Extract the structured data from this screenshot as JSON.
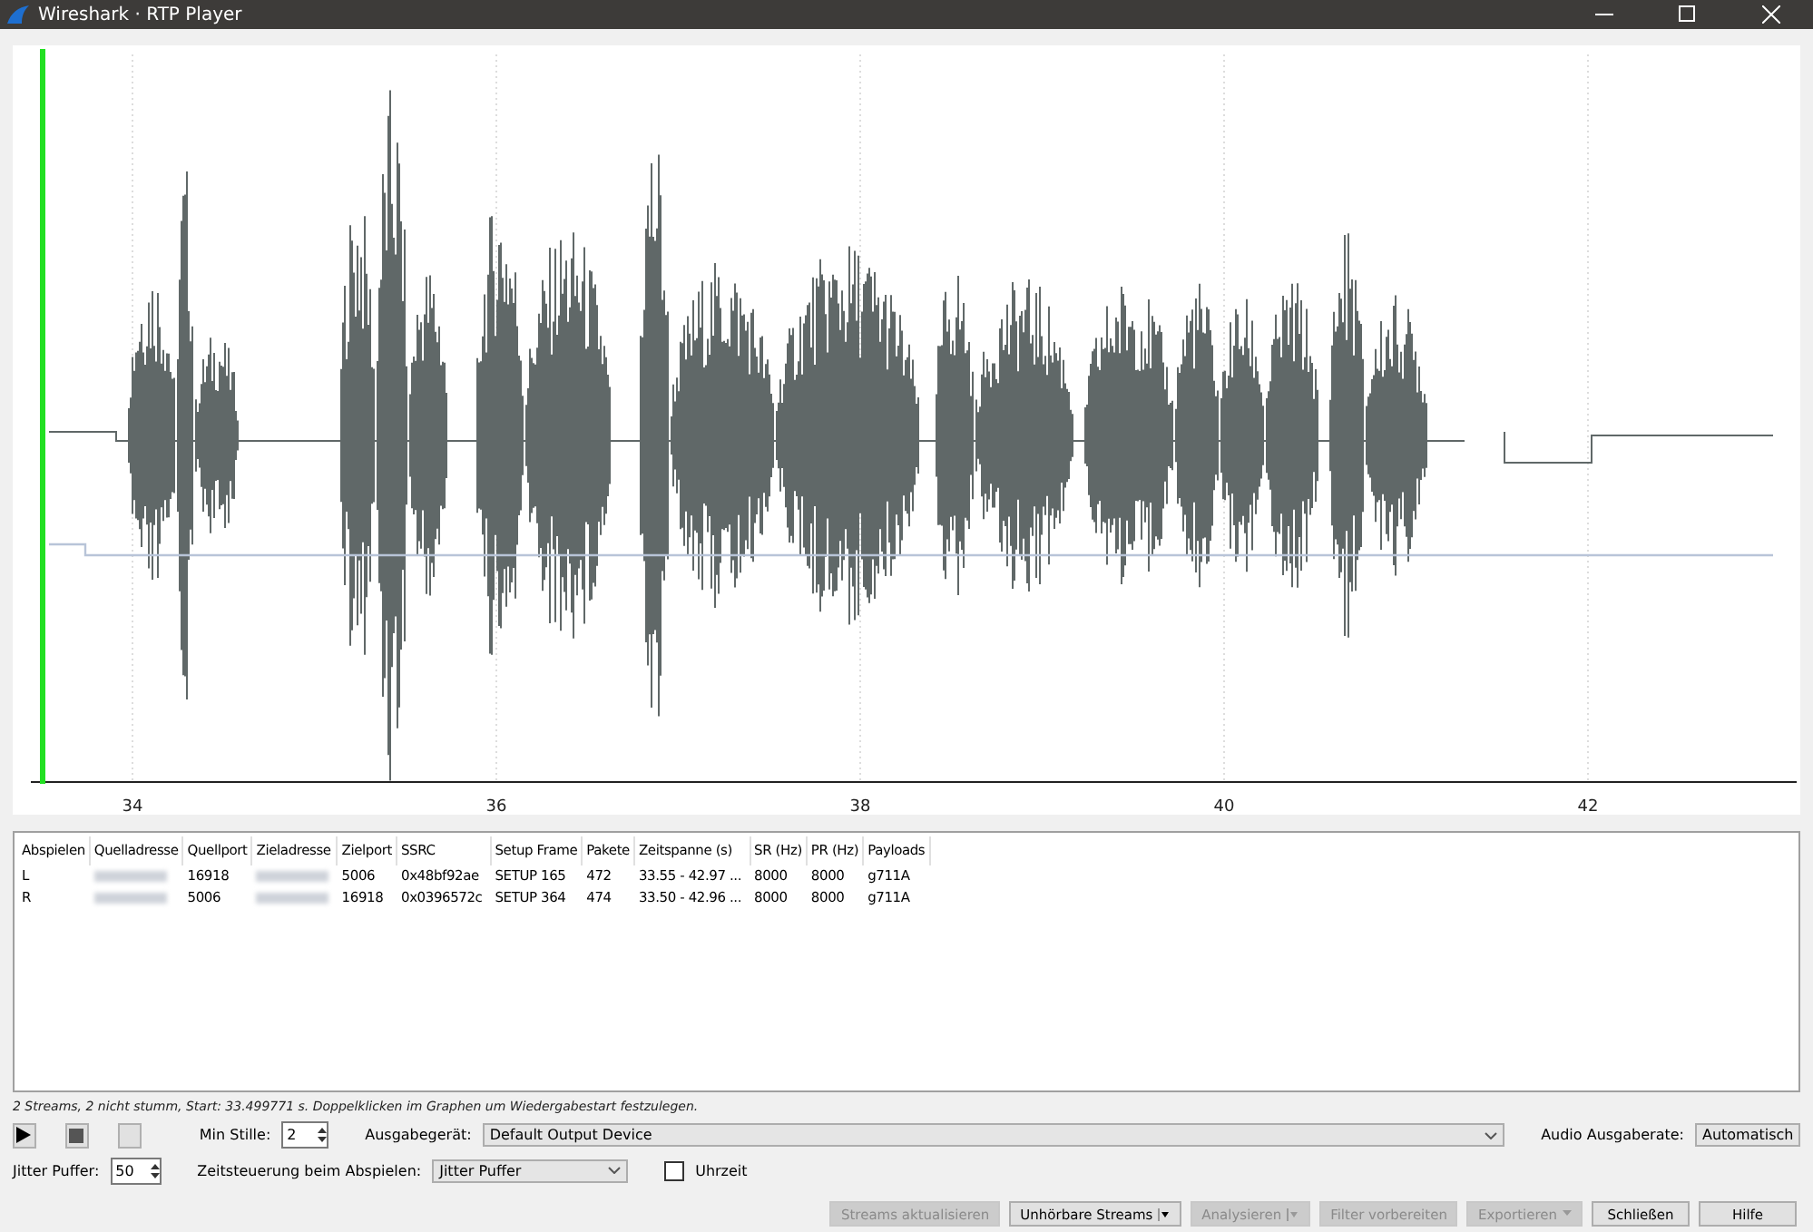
{
  "window": {
    "title": "Wireshark · RTP Player"
  },
  "graph": {
    "axis_ticks": [
      "34",
      "36",
      "38",
      "40",
      "42"
    ]
  },
  "table": {
    "columns": [
      "Abspielen",
      "Quelladresse",
      "Quellport",
      "Zieladresse",
      "Zielport",
      "SSRC",
      "Setup Frame",
      "Pakete",
      "Zeitspanne (s)",
      "SR (Hz)",
      "PR (Hz)",
      "Payloads"
    ],
    "rows": [
      {
        "cells": [
          "L",
          null,
          "16918",
          null,
          "5006",
          "0x48bf92ae",
          "SETUP 165",
          "472",
          "33.55 - 42.97 ...",
          "8000",
          "8000",
          "g711A"
        ]
      },
      {
        "cells": [
          "R",
          null,
          "5006",
          null,
          "16918",
          "0x0396572c",
          "SETUP 364",
          "474",
          "33.50 - 42.96 ...",
          "8000",
          "8000",
          "g711A"
        ]
      }
    ]
  },
  "status_text": "2 Streams, 2 nicht stumm, Start: 33.499771 s. Doppelklicken im Graphen um Wiedergabestart festzulegen.",
  "controls": {
    "min_silence_label": "Min Stille:",
    "min_silence": "2",
    "output_device_label": "Ausgabegerät:",
    "output_device": "Default Output Device",
    "output_rate_label": "Audio Ausgaberate:",
    "output_rate": "Automatisch",
    "jitter_label": "Jitter Puffer:",
    "jitter": "50",
    "timing_label": "Zeitsteuerung beim Abspielen:",
    "timing": "Jitter Puffer",
    "clock_label": "Uhrzeit",
    "clock_checked": false
  },
  "buttons": [
    {
      "label": "Streams aktualisieren",
      "kind": "button",
      "disabled": true
    },
    {
      "label": "Unhörbare Streams",
      "kind": "split",
      "disabled": false
    },
    {
      "label": "Analysieren",
      "kind": "split",
      "disabled": true
    },
    {
      "label": "Filter vorbereiten",
      "kind": "button",
      "disabled": true
    },
    {
      "label": "Exportieren",
      "kind": "menu",
      "disabled": true
    },
    {
      "label": "Schließen",
      "kind": "button",
      "disabled": false
    },
    {
      "label": "Hilfe",
      "kind": "button",
      "disabled": false
    }
  ]
}
